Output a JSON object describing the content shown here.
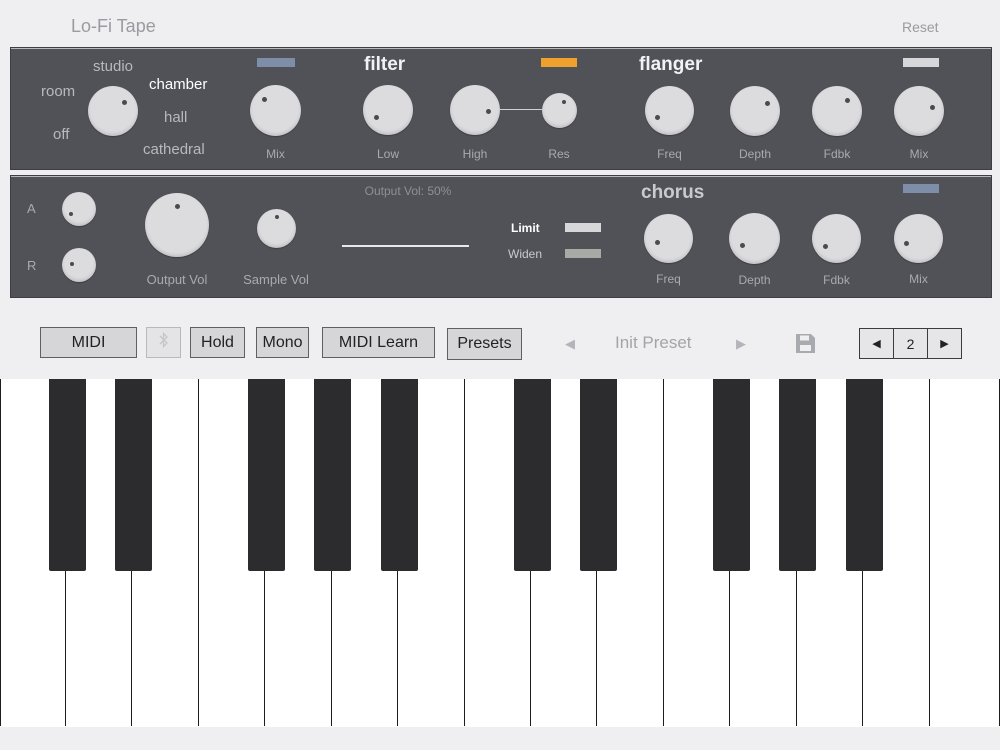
{
  "app": {
    "title": "Lo-Fi Tape",
    "reset_label": "Reset"
  },
  "reverb": {
    "options": [
      "studio",
      "room",
      "chamber",
      "hall",
      "off",
      "cathedral"
    ],
    "selected": "chamber",
    "mix_label": "Mix",
    "mix_toggle_color": "#7e8ea8"
  },
  "filter": {
    "title": "filter",
    "low_label": "Low",
    "high_label": "High",
    "res_label": "Res",
    "toggle_color": "#f0a02c"
  },
  "flanger": {
    "title": "flanger",
    "freq_label": "Freq",
    "depth_label": "Depth",
    "fdbk_label": "Fdbk",
    "mix_label": "Mix",
    "toggle_color": "#d7d7da"
  },
  "envelope": {
    "attack_label": "A",
    "release_label": "R"
  },
  "output": {
    "output_vol_label": "Output Vol",
    "sample_vol_label": "Sample Vol",
    "readout": "Output Vol: 50%",
    "limit_label": "Limit",
    "widen_label": "Widen",
    "limit_color": "#d7d7da",
    "widen_color": "#a8aaa6"
  },
  "chorus": {
    "title": "chorus",
    "freq_label": "Freq",
    "depth_label": "Depth",
    "fdbk_label": "Fdbk",
    "mix_label": "Mix",
    "toggle_color": "#7e8ea8"
  },
  "controls": {
    "midi_label": "MIDI",
    "bluetooth_icon": "bluetooth-icon",
    "hold_label": "Hold",
    "mono_label": "Mono",
    "midi_learn_label": "MIDI Learn",
    "presets_label": "Presets",
    "preset_name": "Init Preset",
    "prev_icon": "triangle-left-icon",
    "next_icon": "triangle-right-icon",
    "save_icon": "floppy-disk-icon",
    "octave_value": "2"
  },
  "colors": {
    "panel": "#505258",
    "knob": "#dcdcdf",
    "background": "#efeff1"
  }
}
